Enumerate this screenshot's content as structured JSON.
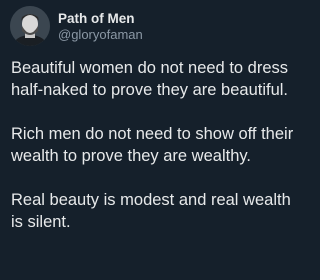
{
  "author": {
    "display_name": "Path of Men",
    "handle": "@gloryofaman",
    "avatar_icon": "profile-photo"
  },
  "tweet": {
    "paragraphs": [
      "Beautiful women do not need to dress half-naked to prove they are beautiful.",
      "Rich men do not need to show off their wealth to prove they are wealthy.",
      "Real beauty is modest and real wealth is silent."
    ]
  },
  "colors": {
    "background": "#15202b",
    "text": "#e7e9ea",
    "secondary_text": "#8b98a5"
  }
}
